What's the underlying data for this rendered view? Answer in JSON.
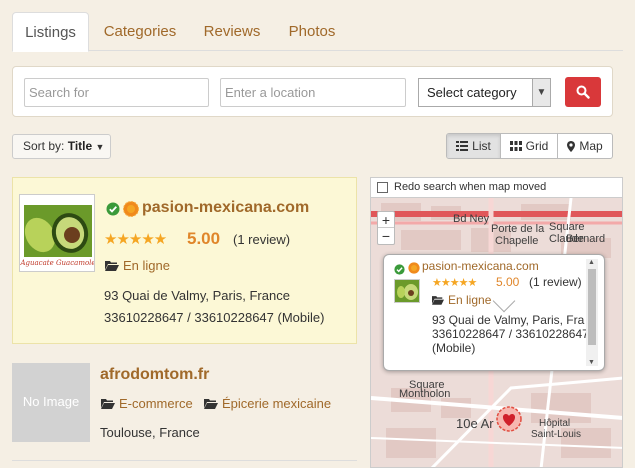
{
  "tabs": [
    {
      "label": "Listings",
      "active": true
    },
    {
      "label": "Categories",
      "active": false
    },
    {
      "label": "Reviews",
      "active": false
    },
    {
      "label": "Photos",
      "active": false
    }
  ],
  "search": {
    "keyword_placeholder": "Search for",
    "location_placeholder": "Enter a location",
    "category_selected": "Select category",
    "button_icon": "search-icon"
  },
  "sort": {
    "prefix": "Sort by:",
    "value": "Title"
  },
  "view_modes": [
    {
      "label": "List",
      "icon": "list-icon",
      "active": true
    },
    {
      "label": "Grid",
      "icon": "grid-icon",
      "active": false
    },
    {
      "label": "Map",
      "icon": "map-marker-icon",
      "active": false
    }
  ],
  "listings": [
    {
      "title": "pasion-mexicana.com",
      "featured": true,
      "verified": true,
      "rating_value": "5.00",
      "stars": 5,
      "review_count": "(1 review)",
      "categories": [
        "En ligne"
      ],
      "address": "93 Quai de Valmy, Paris, France",
      "phone": "33610228647 / 33610228647 (Mobile)",
      "thumb_caption": "Aguacate Guacamole"
    },
    {
      "title": "afrodomtom.fr",
      "featured": false,
      "verified": false,
      "thumb_text": "No Image",
      "categories": [
        "E-commerce",
        "Épicerie mexicaine"
      ],
      "address": "Toulouse, France"
    }
  ],
  "map": {
    "redo_label": "Redo search when map moved",
    "zoom_in": "+",
    "zoom_out": "−",
    "street_labels": [
      "Bd Ney",
      "Porte de la",
      "Chapelle",
      "Square Claude",
      "Bernard",
      "Square",
      "Montholon",
      "10e Ar",
      "Hôpital",
      "Saint-Louis"
    ],
    "popup": {
      "title": "pasion-mexicana.com",
      "rating_value": "5.00",
      "review_count": "(1 review)",
      "category": "En ligne",
      "address": "93 Quai de Valmy, Paris, Fra",
      "phone": "33610228647 / 33610228647",
      "phone_suffix": "(Mobile)"
    }
  },
  "colors": {
    "background": "#f5efe4",
    "link": "#a0692a",
    "accent_red": "#d9383a",
    "star": "#f5a623",
    "featured_bg": "#fcf8d6",
    "verified": "#3a9a3a",
    "badge_orange": "#f08a1c"
  }
}
